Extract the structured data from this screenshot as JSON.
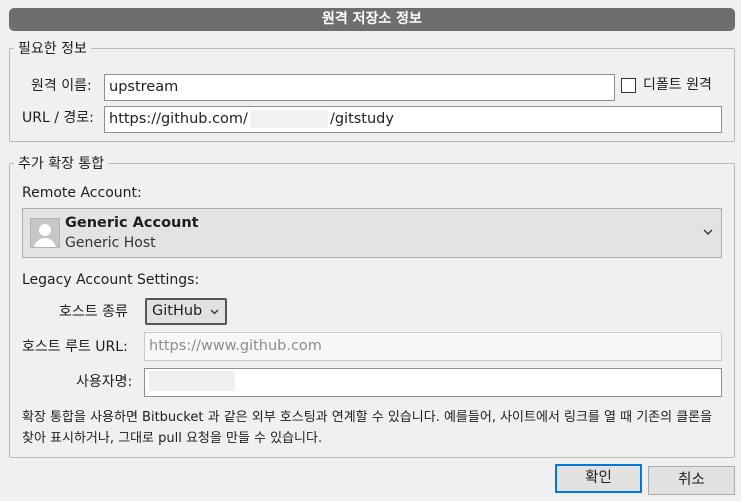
{
  "window": {
    "title": "원격 저장소 정보"
  },
  "required_info": {
    "legend": "필요한 정보",
    "remote_name_label": "원격 이름:",
    "remote_name_value": "upstream",
    "default_remote_label": "디폴트 원격",
    "url_label": "URL / 경로:",
    "url_prefix": "https://github.com/",
    "url_suffix": "/gitstudy"
  },
  "extended_integration": {
    "legend": "추가 확장 통합",
    "remote_account_label": "Remote Account:",
    "account": {
      "name": "Generic Account",
      "host": "Generic Host",
      "icon": "user-avatar-icon"
    },
    "legacy_label": "Legacy Account Settings:",
    "host_type_label": "호스트 종류",
    "host_type_value": "GitHub",
    "host_root_label": "호스트 루트 URL:",
    "host_root_value": "https://www.github.com",
    "username_label": "사용자명:",
    "description": "확장 통합을 사용하면 Bitbucket 과 같은 외부 호스팅과 연계할 수 있습니다. 예를들어, 사이트에서 링크를 열 때 기존의 클론을 찾아 표시하거나, 그대로 pull 요청을 만들 수 있습니다."
  },
  "buttons": {
    "ok": "확인",
    "cancel": "취소"
  }
}
